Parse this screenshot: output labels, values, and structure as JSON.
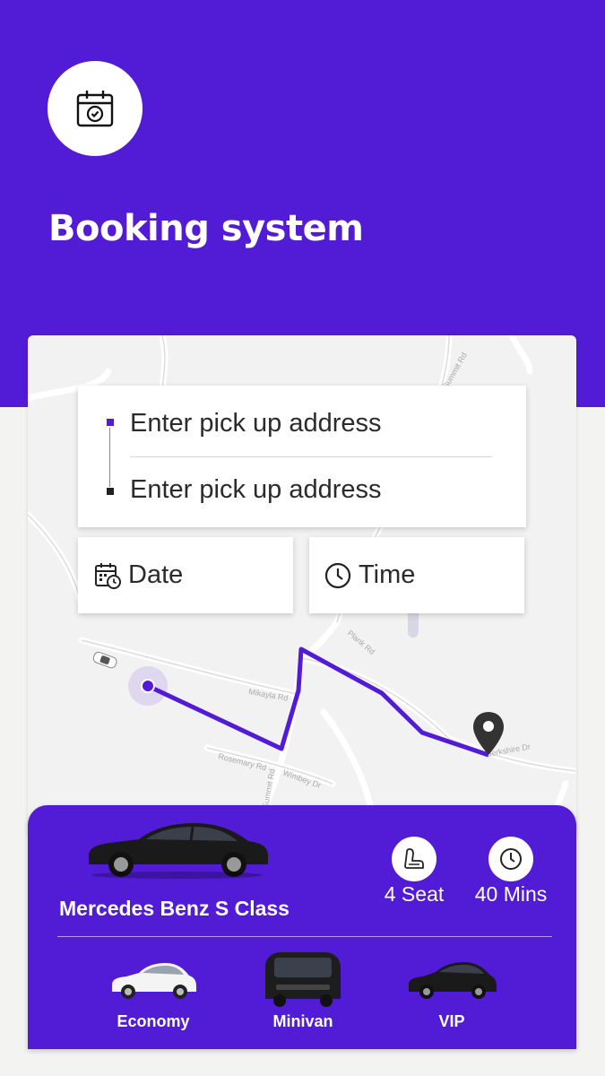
{
  "header": {
    "title": "Booking system",
    "icon": "calendar-check-icon"
  },
  "booking_form": {
    "pickup_placeholder": "Enter pick up address",
    "dropoff_placeholder": "Enter pick up address",
    "date_label": "Date",
    "time_label": "Time"
  },
  "map": {
    "street_labels": [
      "Summit Rd",
      "Plank Rd",
      "Mikayla Rd",
      "Rosemary Rd",
      "Wimbey Dr",
      "Summit Rd",
      "Berkshire Dr"
    ]
  },
  "vehicle": {
    "name": "Mercedes Benz S Class",
    "seats_label": "4 Seat",
    "duration_label": "40 Mins"
  },
  "vehicle_options": [
    {
      "label": "Economy"
    },
    {
      "label": "Minivan"
    },
    {
      "label": "VIP"
    }
  ],
  "colors": {
    "brand": "#521bd6",
    "background": "#f3f4f2",
    "card": "#ffffff"
  }
}
